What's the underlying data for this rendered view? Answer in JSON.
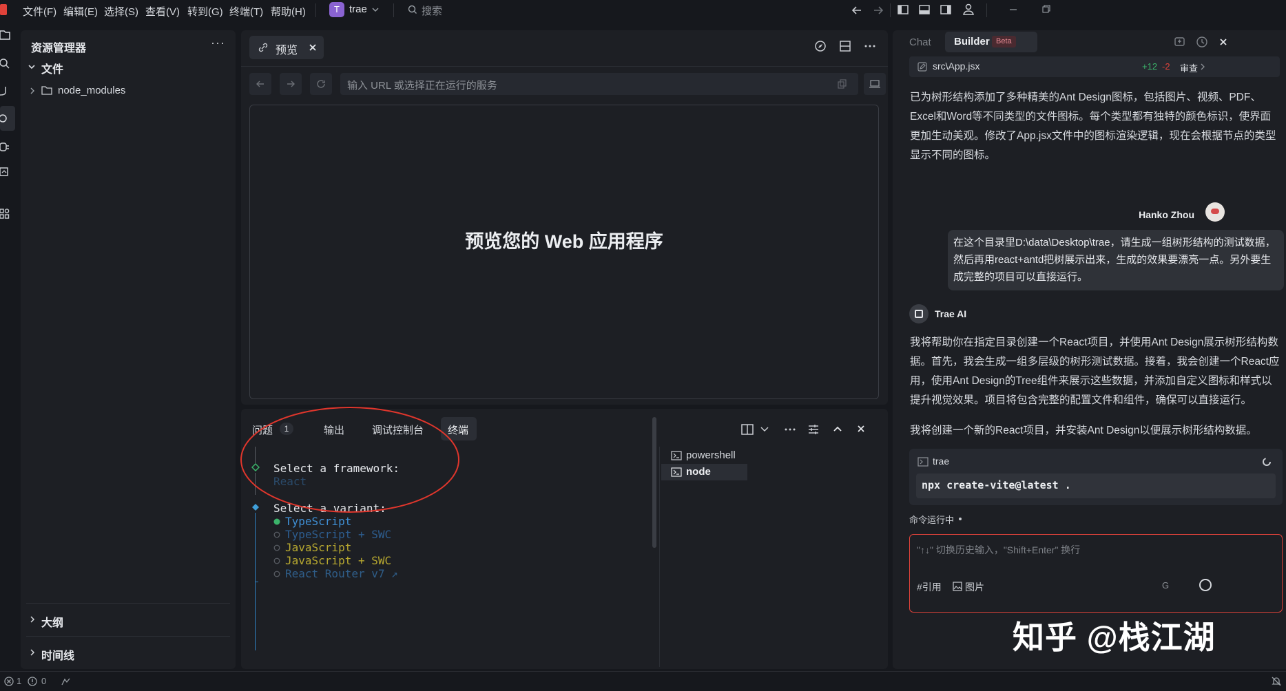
{
  "menubar": {
    "items": [
      "文件(F)",
      "编辑(E)",
      "选择(S)",
      "查看(V)",
      "转到(G)",
      "终端(T)",
      "帮助(H)"
    ],
    "project_initial": "T",
    "project_name": "trae",
    "search_placeholder": "搜索"
  },
  "sidebar": {
    "title": "资源管理器",
    "more": "···",
    "section_files": "文件",
    "tree": [
      {
        "name": "node_modules",
        "type": "folder"
      }
    ],
    "section_outline": "大纲",
    "section_timeline": "时间线"
  },
  "preview": {
    "tab_label": "预览",
    "url_placeholder": "输入 URL 或选择正在运行的服务",
    "placeholder_title": "预览您的 Web 应用程序"
  },
  "bottom_panel": {
    "tabs": [
      {
        "label": "问题",
        "badge": "1"
      },
      {
        "label": "输出"
      },
      {
        "label": "调试控制台"
      },
      {
        "label": "终端",
        "active": true
      }
    ],
    "terminal_lines": {
      "framework_prompt": "Select a framework:",
      "framework_value": "React",
      "variant_prompt": "Select a variant:",
      "options": [
        {
          "text": "TypeScript",
          "selected": true,
          "color": "#3f8fd4"
        },
        {
          "text": "TypeScript + SWC",
          "selected": false,
          "color": "#2d5d8f"
        },
        {
          "text": "JavaScript",
          "selected": false,
          "color": "#b7a830"
        },
        {
          "text": "JavaScript + SWC",
          "selected": false,
          "color": "#b7a830"
        },
        {
          "text": "React Router v7 ↗",
          "selected": false,
          "color": "#2f5e8a"
        }
      ]
    },
    "terminal_list": [
      "powershell",
      "node"
    ]
  },
  "chat": {
    "tab_chat": "Chat",
    "tab_builder": "Builder",
    "beta_badge": "Beta",
    "file_change": {
      "path": "src\\App.jsx",
      "added": "+12",
      "removed": "-2",
      "review": "审查"
    },
    "ai_message_1": "已为树形结构添加了多种精美的Ant Design图标，包括图片、视频、PDF、Excel和Word等不同类型的文件图标。每个类型都有独特的颜色标识，使界面更加生动美观。修改了App.jsx文件中的图标渲染逻辑，现在会根据节点的类型显示不同的图标。",
    "user_name": "Hanko Zhou",
    "user_message": "在这个目录里D:\\data\\Desktop\\trae，请生成一组树形结构的测试数据，然后再用react+antd把树展示出来，生成的效果要漂亮一点。另外要生成完整的项目可以直接运行。",
    "ai_name": "Trae AI",
    "ai_message_2": "我将帮助你在指定目录创建一个React项目，并使用Ant Design展示树形结构数据。首先，我会生成一组多层级的树形测试数据。接着，我会创建一个React应用，使用Ant Design的Tree组件来展示这些数据，并添加自定义图标和样式以提升视觉效果。项目将包含完整的配置文件和组件，确保可以直接运行。",
    "ai_message_3": "我将创建一个新的React项目，并安装Ant Design以便展示树形结构数据。",
    "terminal_card": {
      "title": "trae",
      "command": "npx create-vite@latest ."
    },
    "running_status": "命令运行中",
    "input_placeholder": "\"↑↓\" 切换历史输入，\"Shift+Enter\" 换行",
    "input_ref": "#引用",
    "input_image": "图片",
    "input_model": "G"
  },
  "watermark": "知乎 @栈江湖",
  "statusbar": {
    "errors": "1",
    "warnings": "0"
  },
  "colors": {
    "accent_red": "#e0423a",
    "annotation_red": "#e0362c",
    "green": "#3bb36a"
  }
}
